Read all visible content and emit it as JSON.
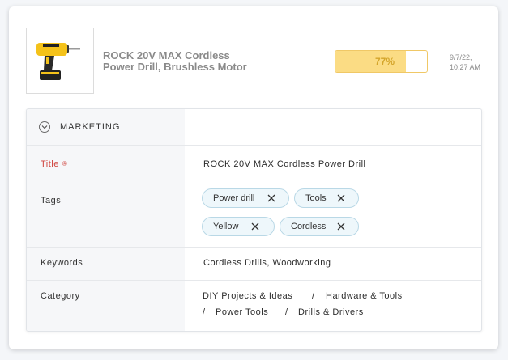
{
  "product": {
    "name_line1": "ROCK 20V MAX Cordless",
    "name_line2": "Power Drill, Brushless Motor",
    "image_icon": "power-drill",
    "completeness": "77%",
    "completeness_value": 0.77,
    "updated_date": "9/7/22,",
    "updated_time": "10:27 AM"
  },
  "section": {
    "title": "MARKETING",
    "toggle_icon": "chevron-down-circle-icon"
  },
  "fields": {
    "title_label": "Title",
    "title_required_mark": "®",
    "title_value": "ROCK 20V MAX Cordless Power Drill",
    "tags_label": "Tags",
    "tags": [
      "Power drill",
      "Tools",
      "Yellow",
      "Cordless"
    ],
    "keywords_label": "Keywords",
    "keywords_value": "Cordless Drills, Woodworking",
    "category_label": "Category",
    "category_path": [
      "DIY Projects & Ideas",
      "Hardware & Tools",
      "Power Tools",
      "Drills & Drivers"
    ],
    "category_separator": "/"
  },
  "colors": {
    "progress_fill": "#fbdc84",
    "progress_text": "#d4a52a",
    "required": "#d0453f",
    "tag_bg": "#eef7fb",
    "tag_border": "#b9d8e6"
  }
}
